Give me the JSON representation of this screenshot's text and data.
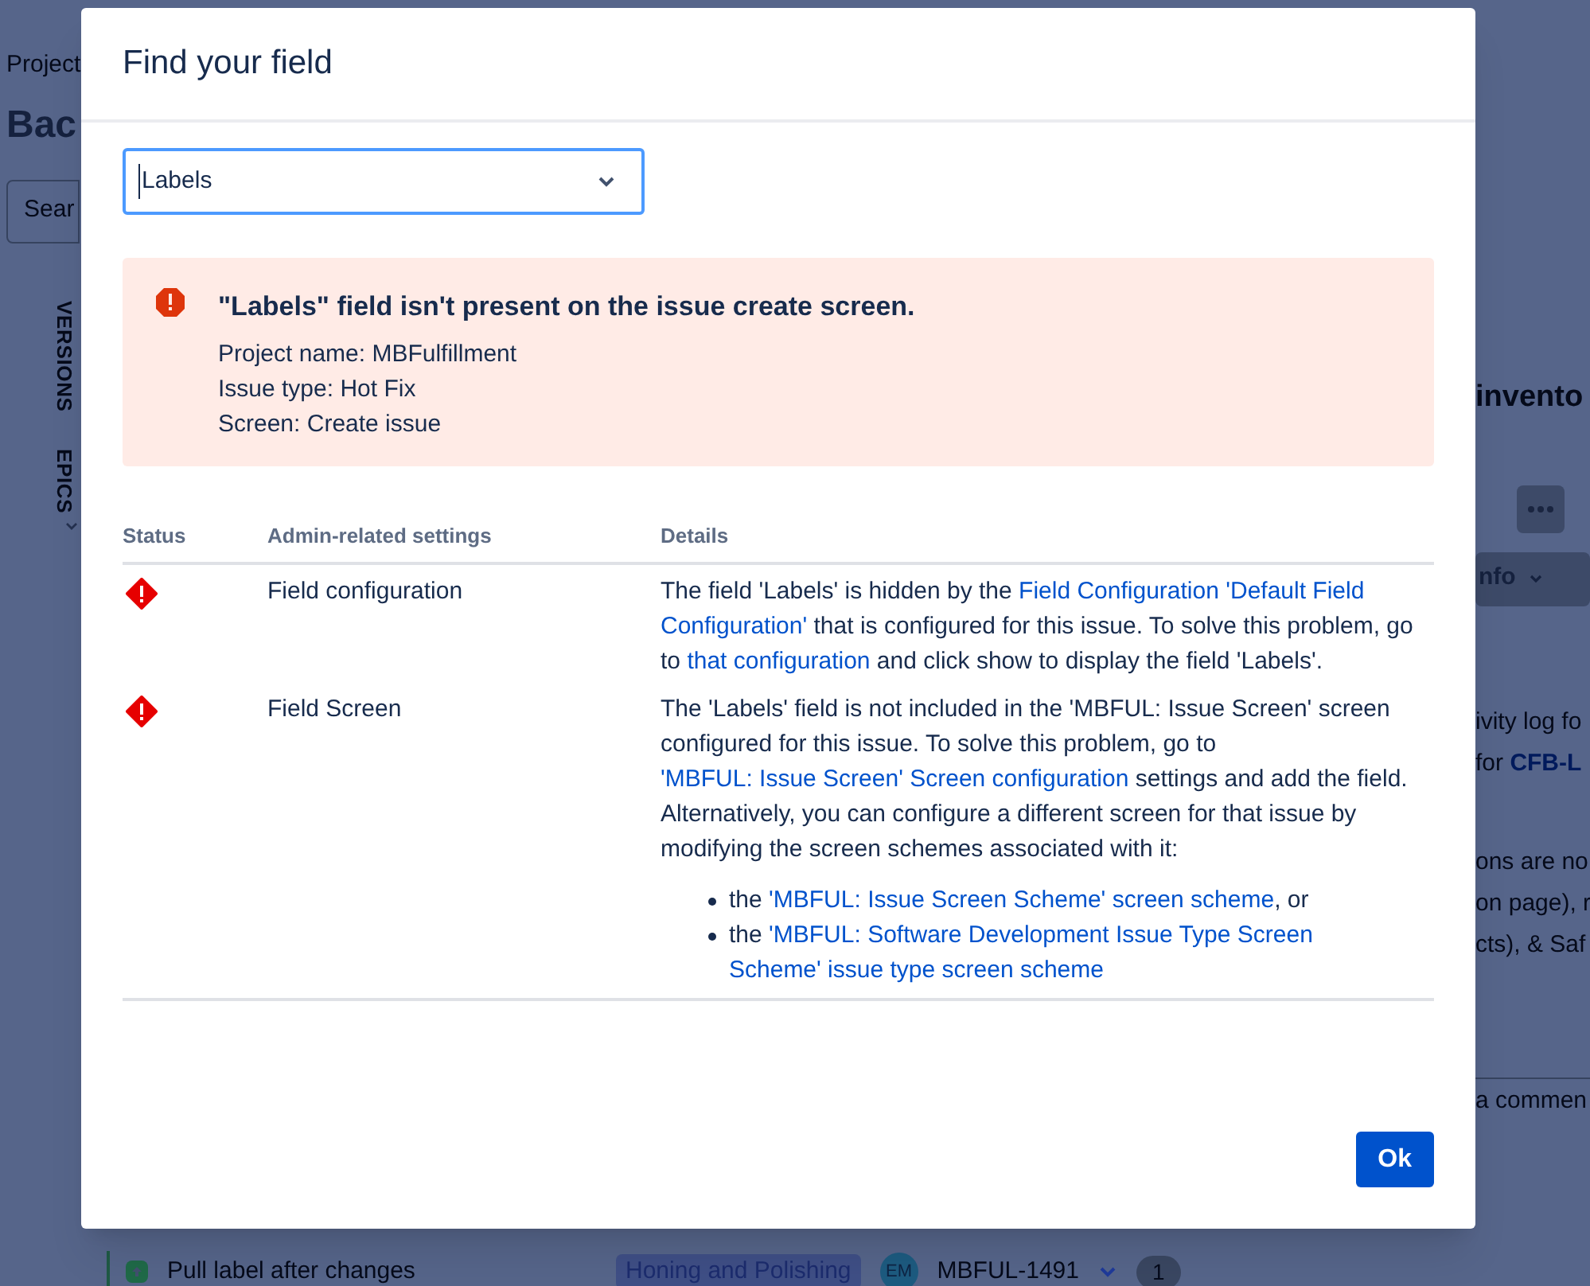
{
  "background": {
    "breadcrumb": "Project",
    "title": "Bac",
    "search_placeholder": "Sear",
    "sidebar_tabs": [
      "VERSIONS",
      "EPICS"
    ],
    "right_title": "invento",
    "right_button": "nfo",
    "right_lines": [
      {
        "text": "ivity log fo"
      },
      {
        "text": "for ",
        "link": "CFB-L"
      },
      {
        "text": "ons are no"
      },
      {
        "text": "on page), r"
      },
      {
        "text": "cts), & Saf"
      }
    ],
    "comment_placeholder": "a commen",
    "row": {
      "summary": "Pull label after changes",
      "epic": "Honing and Polishing",
      "assignee": "EM",
      "key": "MBFUL-1491",
      "count": "1"
    }
  },
  "dialog": {
    "title": "Find your field",
    "field": {
      "value": "Labels"
    },
    "banner": {
      "title": "\"Labels\" field isn't present on the issue create screen.",
      "lines": [
        "Project name: MBFulfillment",
        "Issue type: Hot Fix",
        "Screen: Create issue"
      ]
    },
    "table": {
      "columns": [
        "Status",
        "Admin-related settings",
        "Details"
      ],
      "rows": [
        {
          "kind": "error",
          "setting": "Field configuration",
          "details": [
            {
              "text": "The field 'Labels' is hidden by the ",
              "link": false
            },
            {
              "text": "Field Configuration 'Default Field",
              "link": true
            },
            {
              "text": "Configuration'",
              "link": true
            },
            {
              "text": " that is configured for this issue. To solve this problem, go to ",
              "link": false
            },
            {
              "text": "that configuration",
              "link": true
            },
            {
              "text": " and click show to display the field 'Labels'.",
              "link": false
            }
          ],
          "bullets": []
        },
        {
          "kind": "error",
          "setting": "Field Screen",
          "details": [
            {
              "text": "The 'Labels' field is not included in the 'MBFUL: Issue Screen' screen configured for this issue. To solve this problem, go to ",
              "link": false
            },
            {
              "text": "'MBFUL: Issue Screen' Screen configuration",
              "link": true
            },
            {
              "text": " settings and add the field. Alternatively, you can configure a different screen for that issue by modifying the screen schemes associated with it:",
              "link": false
            }
          ],
          "bullets": [
            [
              {
                "text": "the ",
                "link": false
              },
              {
                "text": "'MBFUL: Issue Screen Scheme' screen scheme",
                "link": true
              },
              {
                "text": ", or",
                "link": false
              }
            ],
            [
              {
                "text": "the ",
                "link": false
              },
              {
                "text": "'MBFUL: Software Development Issue Type Screen",
                "link": true
              },
              {
                "text": "Scheme' issue type screen scheme",
                "link": true
              }
            ]
          ]
        }
      ]
    },
    "button": "Ok"
  }
}
